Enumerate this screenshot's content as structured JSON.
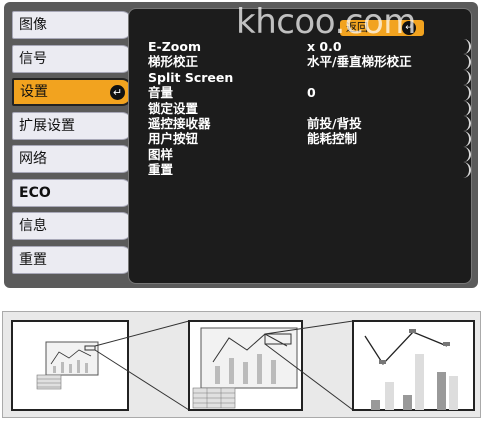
{
  "watermark": "khcoo.com",
  "sidebar": {
    "items": [
      {
        "label": "图像",
        "active": false
      },
      {
        "label": "信号",
        "active": false
      },
      {
        "label": "设置",
        "active": true
      },
      {
        "label": "扩展设置",
        "active": false
      },
      {
        "label": "网络",
        "active": false
      },
      {
        "label": "ECO",
        "active": false
      },
      {
        "label": "信息",
        "active": false
      },
      {
        "label": "重置",
        "active": false
      }
    ],
    "enter_icon": "enter-icon"
  },
  "panel": {
    "return_label": "返回",
    "rows": [
      {
        "label": "E-Zoom",
        "value": "x  0.0"
      },
      {
        "label": "梯形校正",
        "value": "水平/垂直梯形校正"
      },
      {
        "label": "Split Screen",
        "value": ""
      },
      {
        "label": "音量",
        "value": "  0"
      },
      {
        "label": "锁定设置",
        "value": ""
      },
      {
        "label": "遥控接收器",
        "value": "前投/背投"
      },
      {
        "label": "用户按钮",
        "value": "能耗控制"
      },
      {
        "label": "图样",
        "value": ""
      },
      {
        "label": "重置",
        "value": ""
      }
    ]
  },
  "colors": {
    "osd_bg": "#5b5b5b",
    "panel_bg": "#1c1c1c",
    "accent": "#f2a31f",
    "menu_bg": "#ebebf2"
  },
  "illustration": {
    "description_icon": "zoom-sequence-illustration"
  }
}
